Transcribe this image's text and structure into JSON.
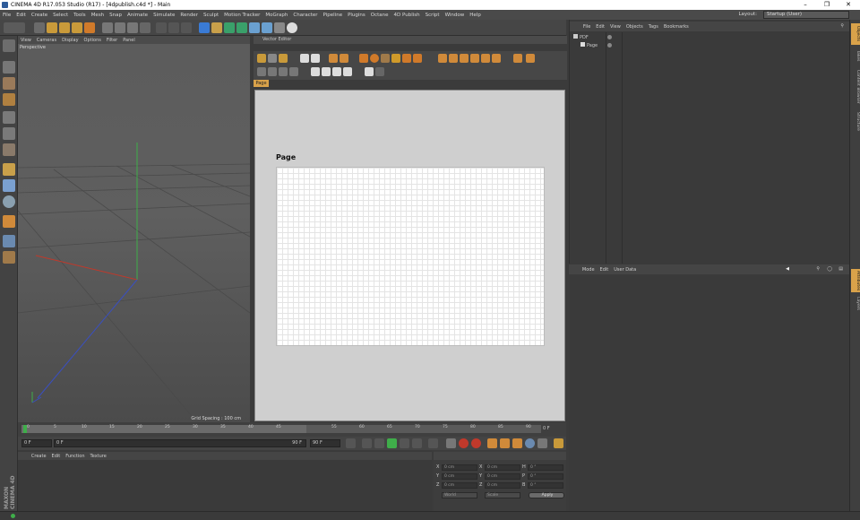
{
  "window": {
    "title": "CINEMA 4D R17.053 Studio (R17) - [4dpublish.c4d *] - Main"
  },
  "menu": [
    "File",
    "Edit",
    "Create",
    "Select",
    "Tools",
    "Mesh",
    "Snap",
    "Animate",
    "Simulate",
    "Render",
    "Sculpt",
    "Motion Tracker",
    "MoGraph",
    "Character",
    "Pipeline",
    "Plugins",
    "Octane",
    "4D Publish",
    "Script",
    "Window",
    "Help"
  ],
  "layout": {
    "label": "Layout:",
    "value": "Startup (User)"
  },
  "viewport": {
    "menu": [
      "View",
      "Cameras",
      "Display",
      "Options",
      "Filter",
      "Panel"
    ],
    "label": "Perspective",
    "grid_spacing": "Grid Spacing : 100 cm"
  },
  "vector_editor": {
    "title": "Vector Editor",
    "tab": "Page",
    "page_label": "Page"
  },
  "objects": {
    "menu": [
      "File",
      "Edit",
      "View",
      "Objects",
      "Tags",
      "Bookmarks"
    ],
    "items": [
      {
        "label": "PDF"
      },
      {
        "label": "Page"
      }
    ]
  },
  "attributes": {
    "menu": [
      "Mode",
      "Edit",
      "User Data"
    ]
  },
  "right_tabs": [
    "Objects",
    "Takes",
    "Content Browser",
    "Structure"
  ],
  "right_tabs_lower": [
    "Attributes",
    "Layers"
  ],
  "timeline": {
    "ticks": [
      "0",
      "5",
      "10",
      "15",
      "20",
      "25",
      "30",
      "35",
      "40",
      "45",
      "50",
      "55",
      "60",
      "65",
      "70",
      "75",
      "80",
      "85",
      "90"
    ],
    "end_frame": "0 F"
  },
  "transport": {
    "start": "0 F",
    "current": "0 F",
    "end": "90 F",
    "end2": "90 F"
  },
  "materials": {
    "menu": [
      "Create",
      "Edit",
      "Function",
      "Texture"
    ]
  },
  "coordinates": {
    "rows": [
      {
        "a": "X",
        "av": "0 cm",
        "b": "X",
        "bv": "0 cm",
        "c": "H",
        "cv": "0 °"
      },
      {
        "a": "Y",
        "av": "0 cm",
        "b": "Y",
        "bv": "0 cm",
        "c": "P",
        "cv": "0 °"
      },
      {
        "a": "Z",
        "av": "0 cm",
        "b": "Z",
        "bv": "0 cm",
        "c": "B",
        "cv": "0 °"
      }
    ],
    "mode1": "World",
    "mode2": "Scale",
    "apply": "Apply"
  },
  "branding": "MAXON CINEMA 4D",
  "colors": {
    "accent": "#d9a24a",
    "page_bg": "#ffffff",
    "canvas_bg": "#cfcfcf"
  }
}
